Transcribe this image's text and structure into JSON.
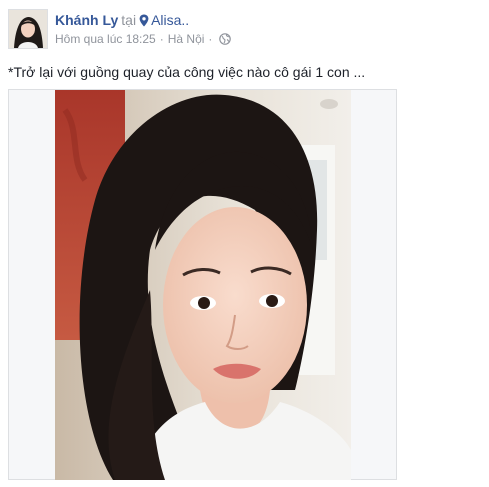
{
  "post": {
    "author": "Khánh Ly",
    "at_word": "tại",
    "place": "Alisa..",
    "timestamp": "Hôm qua lúc 18:25",
    "separator": "·",
    "location": "Hà Nội",
    "caption": "*Trở lại với guồng quay của công việc nào cô gái 1 con ..."
  },
  "icons": {
    "location": "location-pin-icon",
    "privacy": "globe-icon"
  },
  "colors": {
    "author_link": "#365899",
    "meta_text": "#90949c",
    "body_text": "#1d2129"
  }
}
